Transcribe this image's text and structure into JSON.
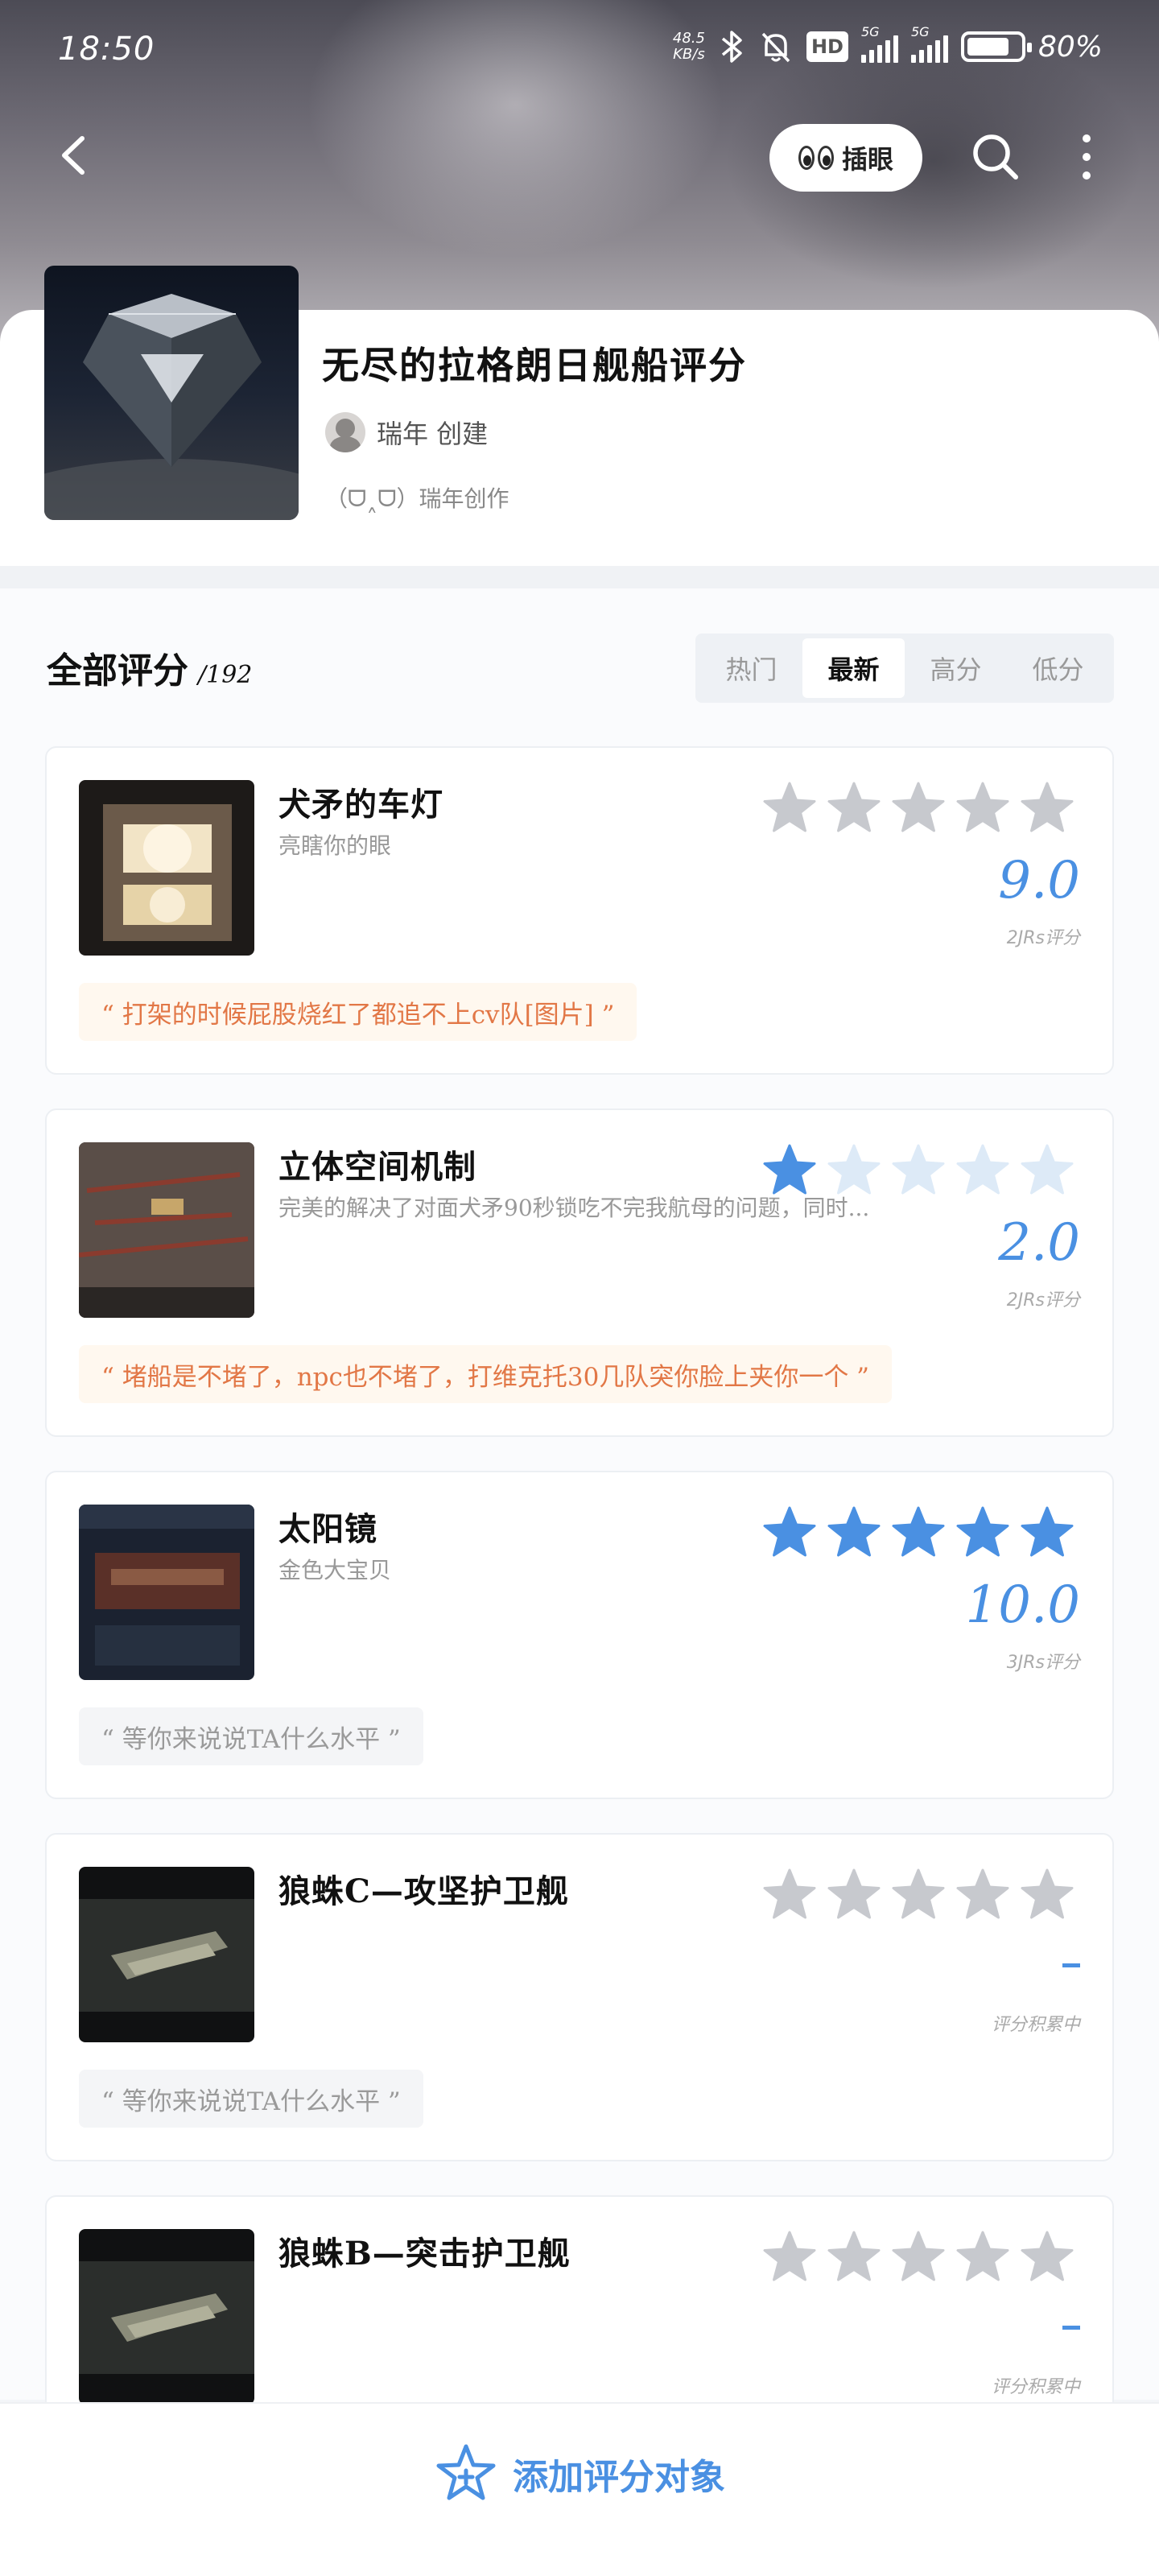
{
  "status_bar": {
    "time": "18:50",
    "net_speed_value": "48.5",
    "net_speed_unit": "KB/s",
    "hd": "HD",
    "signal1_label": "5G",
    "signal2_label": "5G",
    "battery_percent": "80%"
  },
  "nav": {
    "peek_label": "插眼"
  },
  "topic": {
    "title": "无尽的拉格朗日舰船评分",
    "creator": "瑞年 创建",
    "subtitle": "（ᗜ˰ᗜ）瑞年创作"
  },
  "list": {
    "heading": "全部评分",
    "count": "/192",
    "sort_tabs": [
      "热门",
      "最新",
      "高分",
      "低分"
    ],
    "active_sort": "最新"
  },
  "items": [
    {
      "name": "犬矛的车灯",
      "desc": "亮瞎你的眼",
      "score": "9.0",
      "rating_count": "2JRs评分",
      "filled_stars": 0,
      "quote": "“ 打架的时候屁股烧红了都追不上cv队[图片] ”",
      "quote_style": "hot"
    },
    {
      "name": "立体空间机制",
      "desc": "完美的解决了对面犬矛90秒锁吃不完我航母的问题，同时...",
      "score": "2.0",
      "rating_count": "2JRs评分",
      "filled_stars": 1,
      "quote": "“ 堵船是不堵了，npc也不堵了，打维克托30几队突你脸上夹你一个 ”",
      "quote_style": "hot"
    },
    {
      "name": "太阳镜",
      "desc": "金色大宝贝",
      "score": "10.0",
      "rating_count": "3JRs评分",
      "filled_stars": 5,
      "quote": "“ 等你来说说TA什么水平 ”",
      "quote_style": "empty"
    },
    {
      "name": "狼蛛C—攻坚护卫舰",
      "desc": "",
      "score": "",
      "rating_count": "评分积累中",
      "filled_stars": 0,
      "quote": "“ 等你来说说TA什么水平 ”",
      "quote_style": "empty"
    },
    {
      "name": "狼蛛B—突击护卫舰",
      "desc": "",
      "score": "",
      "rating_count": "评分积累中",
      "filled_stars": 0,
      "quote": "",
      "quote_style": "empty"
    }
  ],
  "bottom": {
    "add_label": "添加评分对象"
  },
  "colors": {
    "accent": "#4a90e2",
    "star_empty": "#c7c9ce",
    "star_light": "#ddeaf7",
    "quote_hot": "#e27746"
  }
}
